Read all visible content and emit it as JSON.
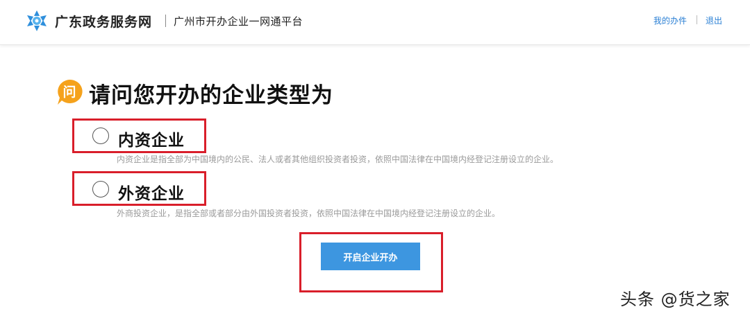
{
  "header": {
    "site_name": "广东政务服务网",
    "platform_name": "广州市开办企业一网通平台",
    "nav": {
      "my_tasks": "我的办件",
      "logout": "退出"
    },
    "logo_icon": "gd-gov-logo-icon",
    "link_color": "#2a7fd4"
  },
  "question": {
    "icon_label": "问",
    "icon": "question-badge-icon",
    "title": "请问您开办的企业类型为"
  },
  "options": [
    {
      "label": "内资企业",
      "description": "内资企业是指全部为中国境内的公民、法人或者其他组织投资者投资，依照中国法律在中国境内经登记注册设立的企业。",
      "selected": false
    },
    {
      "label": "外资企业",
      "description": "外商投资企业，是指全部或者部分由外国投资者投资，依照中国法律在中国境内经登记注册设立的企业。",
      "selected": false
    }
  ],
  "start_button": {
    "label": "开启企业开办",
    "color": "#3d96e0"
  },
  "highlight_color": "#d91e2a",
  "watermark": "头条 @货之家"
}
